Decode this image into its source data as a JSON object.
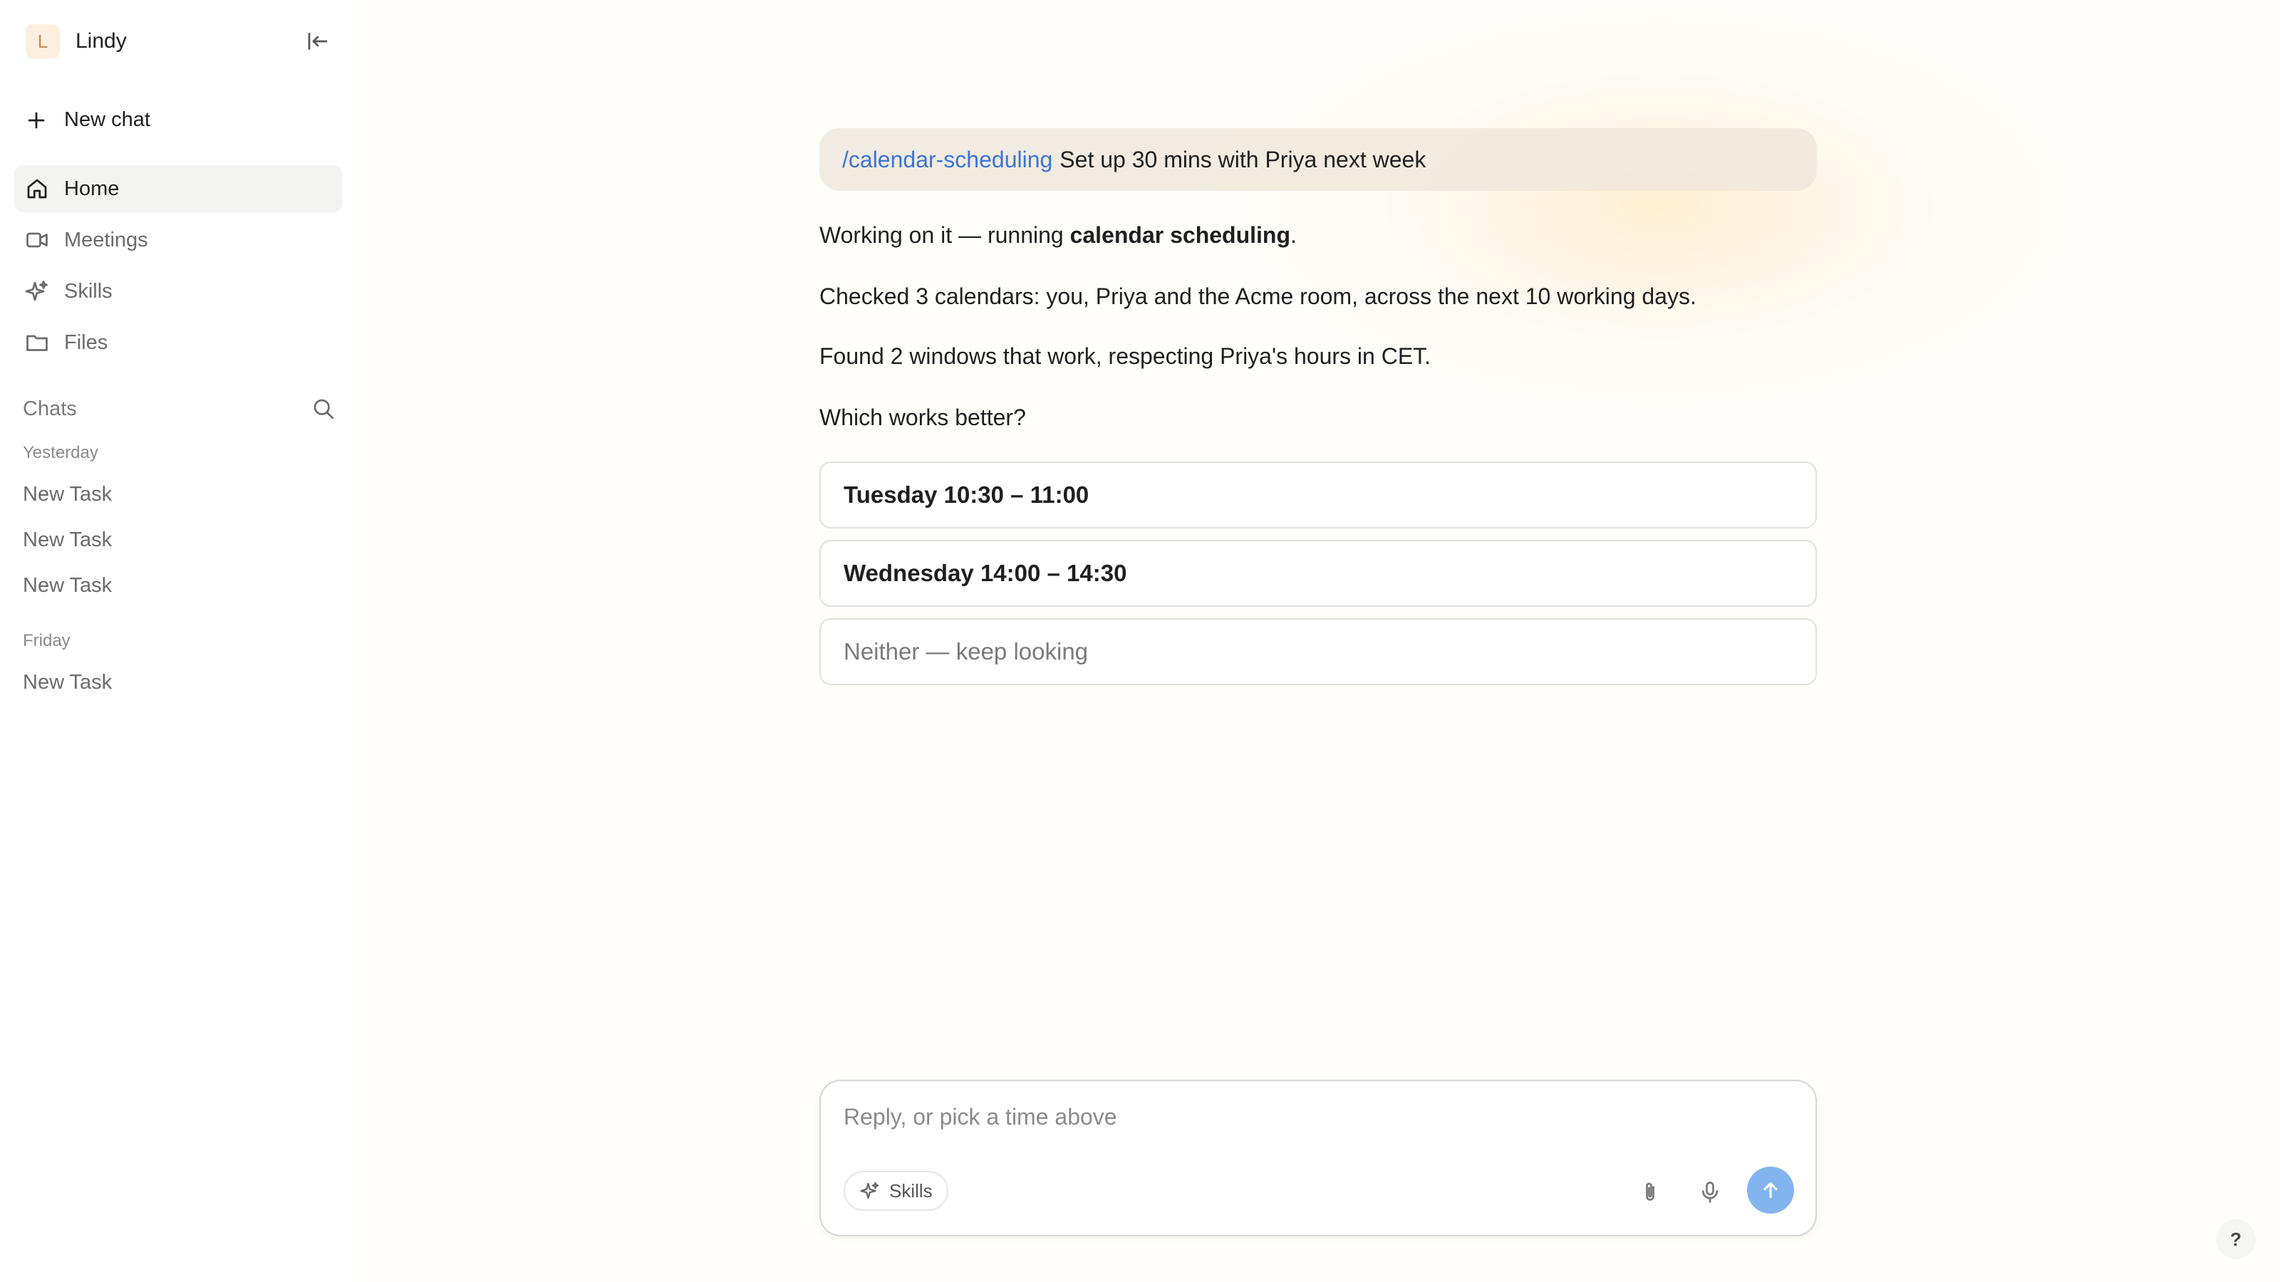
{
  "sidebar": {
    "brand": {
      "initial": "L",
      "name": "Lindy"
    },
    "new_chat_label": "New chat",
    "nav": [
      {
        "label": "Home",
        "icon": "home-icon",
        "active": true
      },
      {
        "label": "Meetings",
        "icon": "video-icon",
        "active": false
      },
      {
        "label": "Skills",
        "icon": "sparkle-icon",
        "active": false
      },
      {
        "label": "Files",
        "icon": "folder-icon",
        "active": false
      }
    ],
    "chats_label": "Chats",
    "groups": [
      {
        "label": "Yesterday",
        "items": [
          "New Task",
          "New Task",
          "New Task"
        ]
      },
      {
        "label": "Friday",
        "items": [
          "New Task"
        ]
      }
    ]
  },
  "conversation": {
    "user_message": {
      "command": "/calendar-scheduling",
      "text": "Set up 30 mins with Priya next week"
    },
    "assistant": {
      "line1_prefix": "Working on it — running ",
      "line1_bold": "calendar scheduling",
      "line1_suffix": ".",
      "line2": "Checked 3 calendars: you, Priya and the Acme room, across the next 10 working days.",
      "line3": "Found 2 windows that work, respecting Priya's hours in CET.",
      "line4": "Which works better?"
    },
    "options": [
      "Tuesday 10:30 – 11:00",
      "Wednesday 14:00 – 14:30",
      "Neither — keep looking"
    ]
  },
  "composer": {
    "placeholder": "Reply, or pick a time above",
    "skills_label": "Skills"
  },
  "help_label": "?",
  "colors": {
    "accent_link": "#3b74d9",
    "send_button": "#82b4f0",
    "active_nav_bg": "#f3f3f1"
  }
}
